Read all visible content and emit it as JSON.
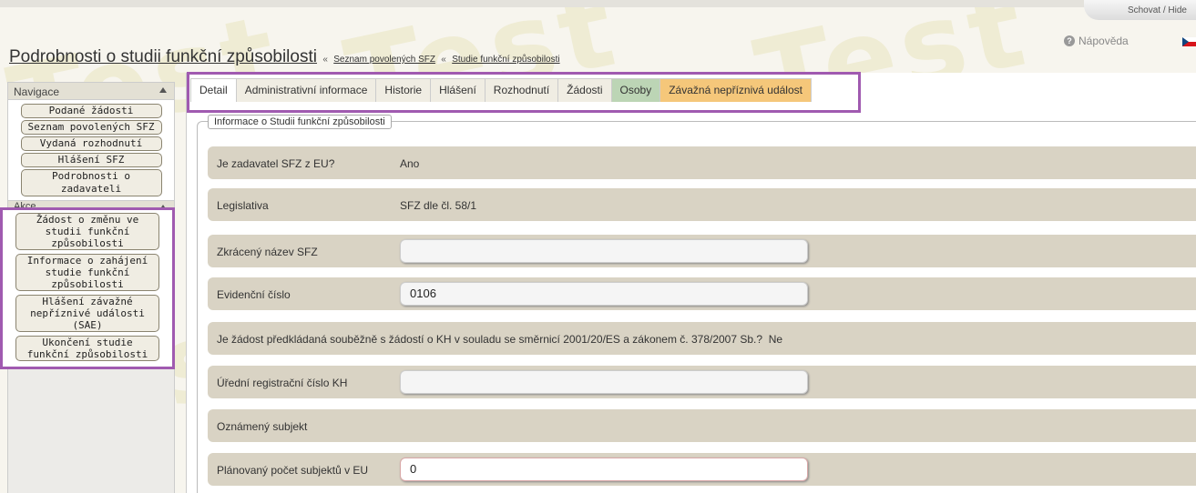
{
  "header": {
    "hide_label": "Schovat / Hide",
    "help_label": "Nápověda",
    "page_title": "Podrobnosti o studii funkční způsobilosti",
    "separator": "«",
    "breadcrumbs": [
      "Seznam povolených SFZ",
      "Studie funkční způsobilosti"
    ],
    "watermark": "Test"
  },
  "sidebar": {
    "nav_title": "Navigace",
    "nav_items": [
      "Podané žádosti",
      "Seznam povolených SFZ",
      "Vydaná rozhodnutí",
      "Hlášení SFZ",
      "Podrobnosti o zadavateli"
    ],
    "akce_title": "Akce",
    "akce_items": [
      "Žádost o změnu ve studii funkční způsobilosti",
      "Informace o zahájení studie funkční způsobilosti",
      "Hlášení závažné nepříznivé události (SAE)",
      "Ukončení studie funkční způsobilosti"
    ]
  },
  "tabs": [
    "Detail",
    "Administrativní informace",
    "Historie",
    "Hlášení",
    "Rozhodnutí",
    "Žádosti",
    "Osoby",
    "Závažná nepříznivá událost"
  ],
  "form": {
    "legend": "Informace o Studii funkční způsobilosti",
    "eu_label": "Je zadavatel SFZ z EU?",
    "eu_value": "Ano",
    "legislativa_label": "Legislativa",
    "legislativa_value": "SFZ dle čl. 58/1",
    "short_name_label": "Zkrácený název SFZ",
    "short_name_value": "",
    "evid_label": "Evidenční číslo",
    "evid_value": "0106",
    "kh_question": "Je žádost předkládaná souběžně s žádostí o KH v souladu se směrnicí 2001/20/ES a zákonem č. 378/2007 Sb.?",
    "kh_answer": "Ne",
    "kh_reg_label": "Úřední registrační číslo KH",
    "kh_reg_value": "",
    "subject_label": "Oznámený subjekt",
    "count_label": "Plánovaný počet subjektů v EU",
    "count_value": "0"
  },
  "colors": {
    "highlight": "#a05ab0",
    "row_bg": "#d9d3c4",
    "tab_green": "#bcd5b5",
    "tab_orange": "#f5c77a"
  }
}
